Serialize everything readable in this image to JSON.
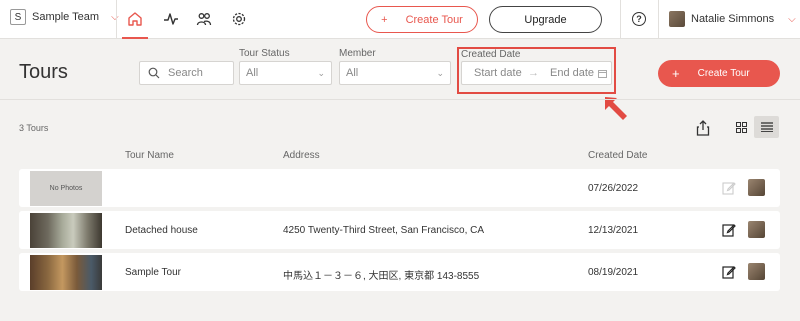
{
  "topbar": {
    "team_logo_letter": "S",
    "team_name": "Sample Team",
    "create_tour_label": "Create Tour",
    "upgrade_label": "Upgrade",
    "help_glyph": "?",
    "user_name": "Natalie Simmons",
    "nav_icons": [
      "home-icon",
      "activity-icon",
      "people-icon",
      "gear-icon"
    ]
  },
  "header": {
    "title": "Tours",
    "search_placeholder": "Search",
    "tour_status_label": "Tour Status",
    "tour_status_value": "All",
    "member_label": "Member",
    "member_value": "All",
    "created_date_label": "Created Date",
    "start_date_placeholder": "Start date",
    "end_date_placeholder": "End date",
    "create_tour_button": "Create Tour"
  },
  "list": {
    "count_text": "3 Tours",
    "columns": [
      "Tour Name",
      "Address",
      "Created Date"
    ],
    "rows": [
      {
        "thumbnail": "No Photos",
        "name": "",
        "address": "",
        "created": "07/26/2022",
        "edit_enabled": false
      },
      {
        "thumbnail": "photo",
        "name": "Detached house",
        "address": "4250 Twenty-Third Street, San Francisco, CA",
        "created": "12/13/2021",
        "edit_enabled": true
      },
      {
        "thumbnail": "photo",
        "name": "Sample Tour",
        "address": "中馬込１－３－６, 大田区, 東京都 143-8555",
        "created": "08/19/2021",
        "edit_enabled": true
      }
    ]
  },
  "colors": {
    "accent": "#e8574e",
    "highlight_box": "#e24b43",
    "background": "#f3f2f0"
  }
}
